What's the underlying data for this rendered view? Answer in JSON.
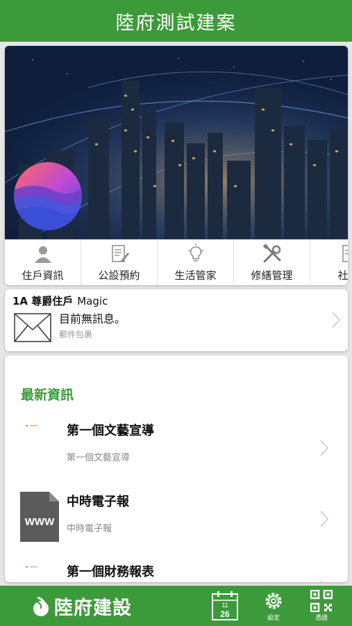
{
  "header": {
    "title": "陸府測試建案"
  },
  "quick_menu": [
    {
      "label": "住戶資訊",
      "icon": "person-icon"
    },
    {
      "label": "公設預約",
      "icon": "edit-document-icon"
    },
    {
      "label": "生活管家",
      "icon": "lightbulb-icon"
    },
    {
      "label": "修繕管理",
      "icon": "tools-icon"
    },
    {
      "label": "社區",
      "icon": "document-icon"
    }
  ],
  "message": {
    "unit": "1A 尊爵住戶",
    "resident": "Magic",
    "text": "目前無訊息。",
    "sub": "郵件包裹"
  },
  "news": {
    "title": "最新資訊",
    "items": [
      {
        "headline": "第一個文藝宣導",
        "desc": "第一個文藝宣導"
      },
      {
        "headline": "中時電子報",
        "desc": "中時電子報",
        "thumb_text": "WWW"
      },
      {
        "headline": "第一個財務報表",
        "desc": ""
      }
    ]
  },
  "bottom_bar": {
    "brand": "陸府建設",
    "calendar": {
      "month": "11",
      "day": "26"
    },
    "settings_label": "設定",
    "qr_label": "憑證"
  },
  "colors": {
    "brand_green": "#3d9a3a",
    "bg": "#e6e6e6"
  }
}
